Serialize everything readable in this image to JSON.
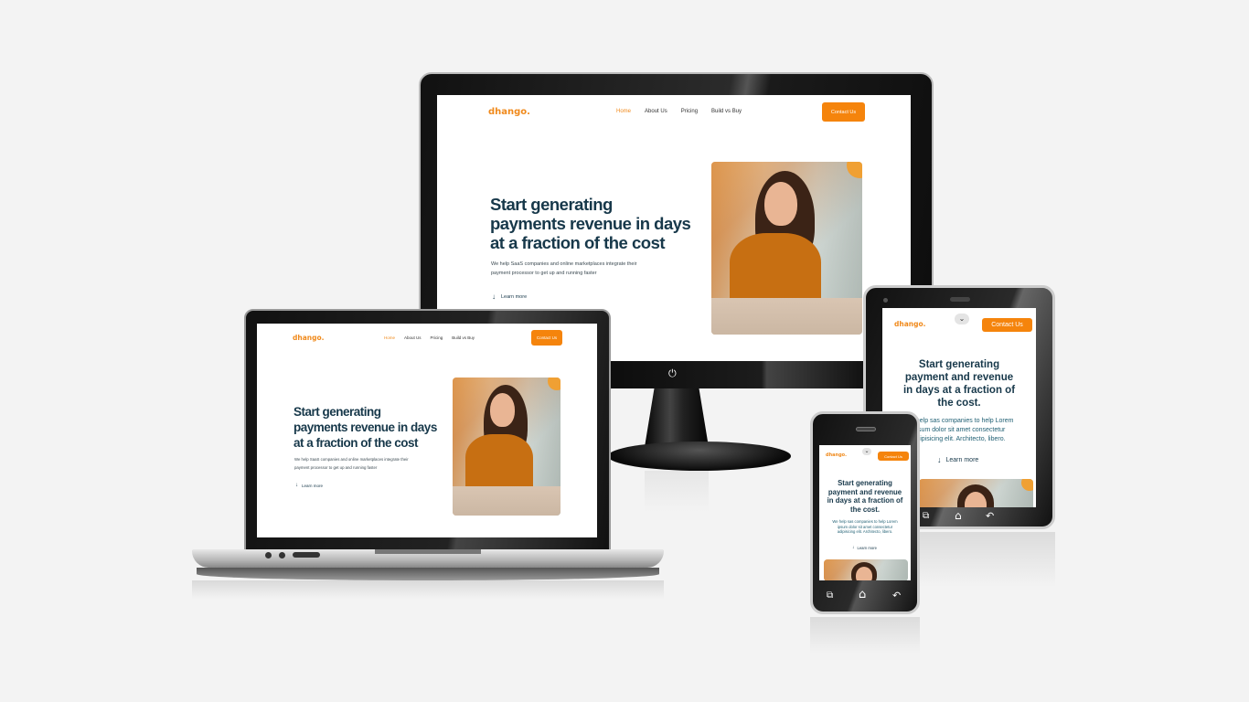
{
  "site": {
    "logo": "dhango.",
    "nav": [
      "Home",
      "About Us",
      "Pricing",
      "Build vs Buy"
    ],
    "cta": "Contact Us",
    "hero_lines": [
      "Start generating",
      "payments revenue in days",
      "at a fraction of the cost"
    ],
    "sub_lines": [
      "We help SaaS companies and online marketplaces integrate their",
      "payment processor to get up and running faster"
    ],
    "learn_more": "Learn more"
  },
  "mobile_site": {
    "logo": "dhango.",
    "cta": "Contact Us",
    "hero_lines": [
      "Start generating",
      "payment and revenue",
      "in days at a fraction of",
      "the cost."
    ],
    "tablet_sub_lines": [
      "We help sas companies to help Lorem",
      "ipsum dolor sit amet consectetur",
      "adipisicing elit. Architecto, libero."
    ],
    "phone_sub_lines": [
      "We help sas companies to help Lorem",
      "ipsum dolor sit amet consectetur",
      "adipisicing elit. Architecto, libero."
    ],
    "learn_more": "Learn more"
  },
  "colors": {
    "accent": "#f5840c",
    "heading": "#17384a",
    "background": "#f3f3f3"
  },
  "icons": {
    "power": "power-icon",
    "arrow": "arrow-down-icon",
    "menu_toggle": "chevron-down-icon",
    "recent": "recent-apps-icon",
    "home": "home-icon",
    "back": "back-icon"
  }
}
